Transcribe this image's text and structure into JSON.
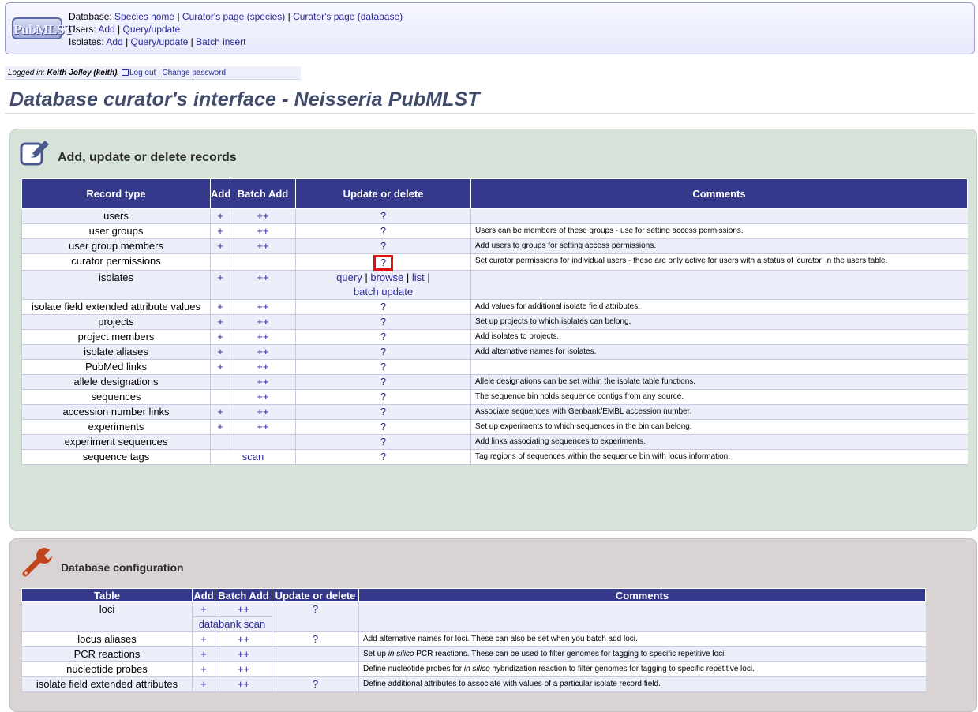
{
  "header": {
    "logo_text": "PubMLST",
    "database_label": "Database:",
    "database_links": [
      "Species home",
      "Curator's page (species)",
      "Curator's page (database)"
    ],
    "users_label": "Users:",
    "users_links": [
      "Add",
      "Query/update"
    ],
    "isolates_label": "Isolates:",
    "isolates_links": [
      "Add",
      "Query/update",
      "Batch insert"
    ]
  },
  "login": {
    "prefix": "Logged in: ",
    "user": "Keith Jolley (keith).",
    "logout": "Log out",
    "change_password": "Change password"
  },
  "page_title": "Database curator's interface - Neisseria PubMLST",
  "records": {
    "heading": "Add, update or delete records",
    "columns": [
      "Record type",
      "Add",
      "Batch Add",
      "Update or delete",
      "Comments"
    ],
    "rows": [
      {
        "type": "users",
        "add": "+",
        "batch": "++",
        "update": "?",
        "comment": ""
      },
      {
        "type": "user groups",
        "add": "+",
        "batch": "++",
        "update": "?",
        "comment": "Users can be members of these groups - use for setting access permissions."
      },
      {
        "type": "user group members",
        "add": "+",
        "batch": "++",
        "update": "?",
        "comment": "Add users to groups for setting access permissions."
      },
      {
        "type": "curator permissions",
        "add": "",
        "batch": "",
        "update": "?",
        "comment": "Set curator permissions for individual users - these are only active for users with a status of 'curator' in the users table."
      },
      {
        "type": "isolates",
        "add": "+",
        "batch": "++",
        "update_links": [
          "query",
          "browse",
          "list",
          "batch update"
        ],
        "comment": ""
      },
      {
        "type": "isolate field extended attribute values",
        "add": "+",
        "batch": "++",
        "update": "?",
        "comment": "Add values for additional isolate field attributes."
      },
      {
        "type": "projects",
        "add": "+",
        "batch": "++",
        "update": "?",
        "comment": "Set up projects to which isolates can belong."
      },
      {
        "type": "project members",
        "add": "+",
        "batch": "++",
        "update": "?",
        "comment": "Add isolates to projects."
      },
      {
        "type": "isolate aliases",
        "add": "+",
        "batch": "++",
        "update": "?",
        "comment": "Add alternative names for isolates."
      },
      {
        "type": "PubMed links",
        "add": "+",
        "batch": "++",
        "update": "?",
        "comment": ""
      },
      {
        "type": "allele designations",
        "add": "",
        "batch": "++",
        "update": "?",
        "comment": "Allele designations can be set within the isolate table functions."
      },
      {
        "type": "sequences",
        "add": "",
        "batch": "++",
        "update": "?",
        "comment": "The sequence bin holds sequence contigs from any source."
      },
      {
        "type": "accession number links",
        "add": "+",
        "batch": "++",
        "update": "?",
        "comment": "Associate sequences with Genbank/EMBL accession number."
      },
      {
        "type": "experiments",
        "add": "+",
        "batch": "++",
        "update": "?",
        "comment": "Set up experiments to which sequences in the bin can belong."
      },
      {
        "type": "experiment sequences",
        "add": "",
        "batch": "",
        "update": "?",
        "comment": "Add links associating sequences to experiments."
      },
      {
        "type": "sequence tags",
        "scan": "scan",
        "update": "?",
        "comment": "Tag regions of sequences within the sequence bin with locus information."
      }
    ]
  },
  "config": {
    "heading": "Database configuration",
    "columns": [
      "Table",
      "Add",
      "Batch Add",
      "Update or delete",
      "Comments"
    ],
    "rows": [
      {
        "type": "loci",
        "add": "+",
        "batch": "++",
        "update": "?",
        "extra": "databank scan",
        "comment": ""
      },
      {
        "type": "locus aliases",
        "add": "+",
        "batch": "++",
        "update": "?",
        "comment": "Add alternative names for loci. These can also be set when you batch add loci."
      },
      {
        "type": "PCR reactions",
        "add": "+",
        "batch": "++",
        "update": "",
        "comment_pre": "Set up ",
        "comment_em": "in silico",
        "comment_post": " PCR reactions. These can be used to filter genomes for tagging to specific repetitive loci."
      },
      {
        "type": "nucleotide probes",
        "add": "+",
        "batch": "++",
        "update": "",
        "comment_pre": "Define nucleotide probes for ",
        "comment_em": "in silico",
        "comment_post": " hybridization reaction to filter genomes for tagging to specific repetitive loci."
      },
      {
        "type": "isolate field extended attributes",
        "add": "+",
        "batch": "++",
        "update": "?",
        "comment": "Define additional attributes to associate with values of a particular isolate record field."
      }
    ]
  },
  "colors": {
    "table_header": "#35398c",
    "link": "#2a2a9a",
    "highlight": "#e01010",
    "title": "#414b6c"
  }
}
